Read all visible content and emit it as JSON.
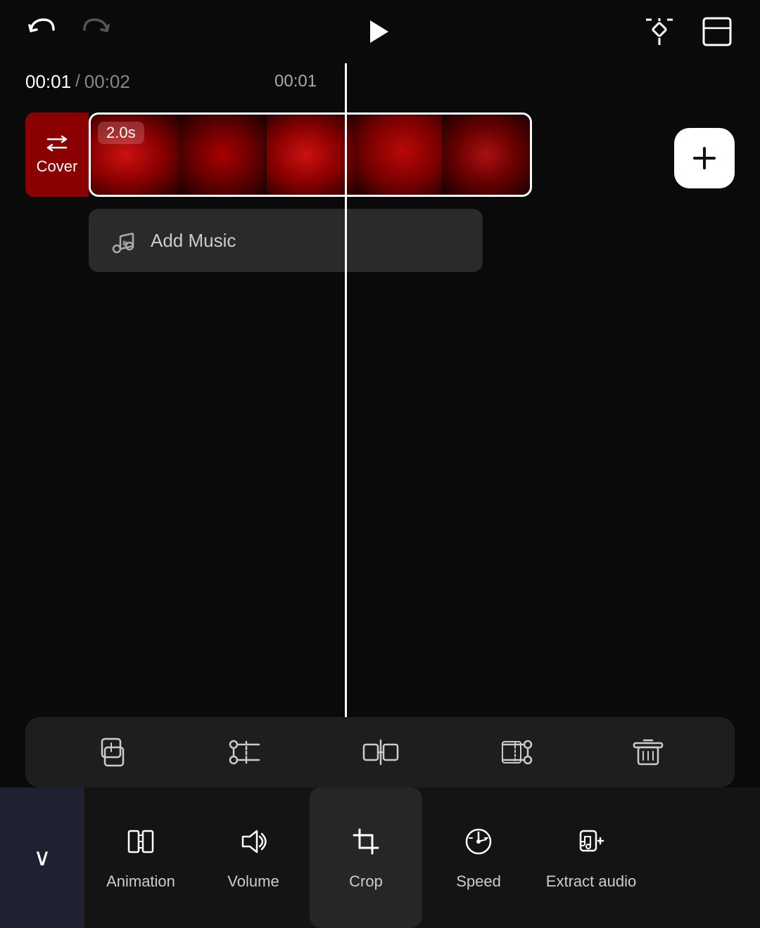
{
  "toolbar": {
    "undo_label": "undo",
    "redo_label": "redo",
    "play_label": "play",
    "keyframe_label": "keyframe",
    "fullscreen_label": "fullscreen"
  },
  "timeline": {
    "current_time": "00:01",
    "total_time": "00:02",
    "separator": "/",
    "marker1": "00:01",
    "clip": {
      "duration": "2.0s"
    }
  },
  "cover": {
    "label": "Cover"
  },
  "music_track": {
    "label": "Add Music"
  },
  "edit_tools": [
    {
      "id": "copy",
      "icon": "⧉",
      "label": "copy"
    },
    {
      "id": "trim-left",
      "icon": "⫶C",
      "label": "trim-left"
    },
    {
      "id": "split",
      "icon": "⫸⫷",
      "label": "split"
    },
    {
      "id": "trim-right",
      "icon": "⫷⫶",
      "label": "trim-right"
    },
    {
      "id": "delete",
      "icon": "🗑",
      "label": "delete"
    }
  ],
  "bottom_tools": [
    {
      "id": "animation",
      "label": "Animation"
    },
    {
      "id": "volume",
      "label": "Volume"
    },
    {
      "id": "crop",
      "label": "Crop"
    },
    {
      "id": "speed",
      "label": "Speed"
    },
    {
      "id": "extract-audio",
      "label": "Extract audio"
    }
  ],
  "add_button_label": "+"
}
